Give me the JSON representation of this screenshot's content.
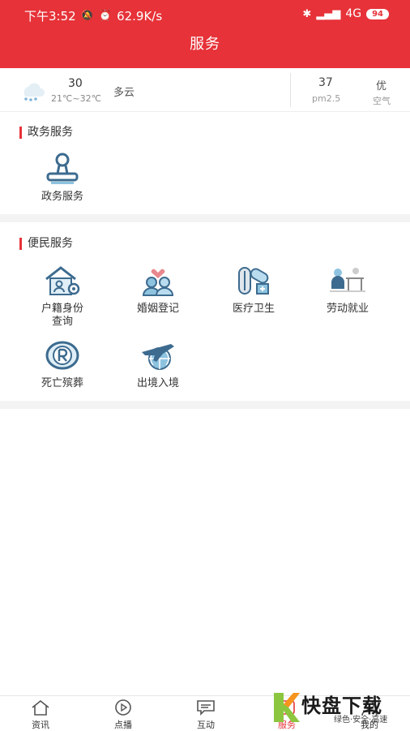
{
  "status_bar": {
    "time": "下午3:52",
    "net_speed": "62.9K/s",
    "network": "4G",
    "battery": "94"
  },
  "header": {
    "title": "服务"
  },
  "weather": {
    "temp": "30",
    "range": "21℃~32℃",
    "desc": "多云",
    "aqi": "37",
    "pm_label": "pm2.5",
    "level": "优",
    "air_label": "空气"
  },
  "sections": {
    "gov": {
      "title": "政务服务",
      "items": [
        {
          "label": "政务服务",
          "icon": "stamp-icon"
        }
      ]
    },
    "civil": {
      "title": "便民服务",
      "items": [
        {
          "label": "户籍身份\n查询",
          "icon": "household-register-icon"
        },
        {
          "label": "婚姻登记",
          "icon": "marriage-icon"
        },
        {
          "label": "医疗卫生",
          "icon": "medical-icon"
        },
        {
          "label": "劳动就业",
          "icon": "employment-icon"
        },
        {
          "label": "死亡殡葬",
          "icon": "funeral-icon"
        },
        {
          "label": "出境入境",
          "icon": "airplane-globe-icon"
        }
      ]
    }
  },
  "tabbar": {
    "items": [
      {
        "label": "资讯",
        "icon": "home-icon"
      },
      {
        "label": "点播",
        "icon": "play-icon"
      },
      {
        "label": "互动",
        "icon": "chat-icon"
      },
      {
        "label": "服务",
        "icon": "service-icon"
      },
      {
        "label": "我的",
        "icon": "user-icon"
      }
    ],
    "active_index": 3
  },
  "watermark": {
    "brand": "快盘下载",
    "tagline": "绿色·安全·高速"
  },
  "colors": {
    "accent": "#e63238",
    "icon_blue": "#3d6b8f",
    "icon_light": "#8ec3e0"
  }
}
